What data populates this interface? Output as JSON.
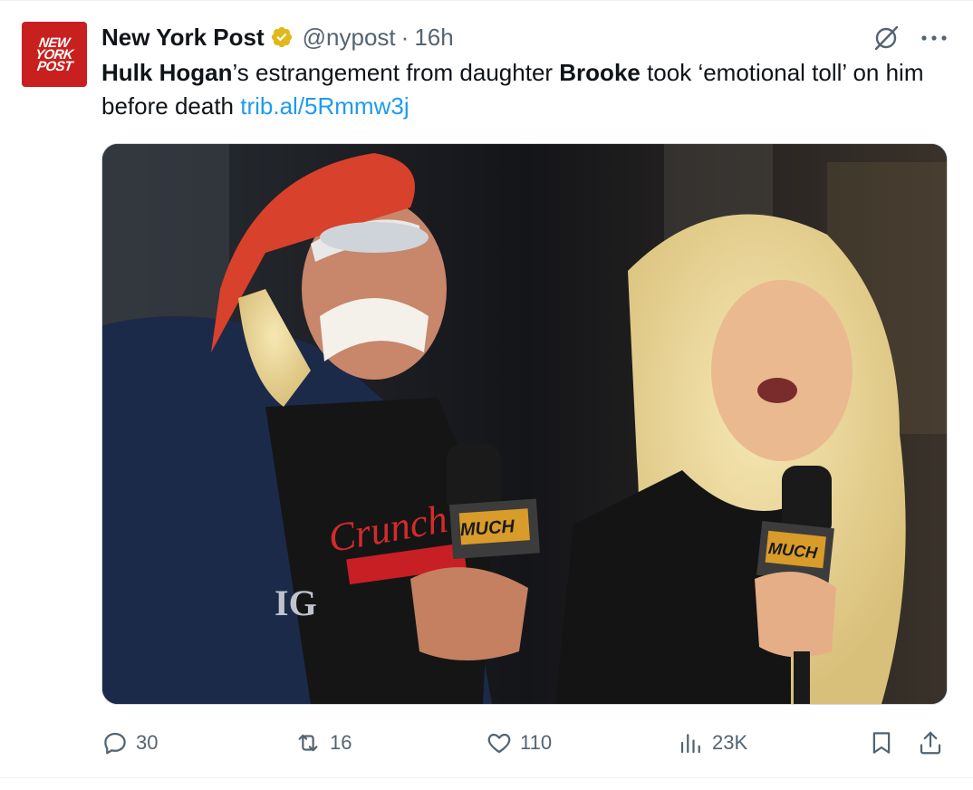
{
  "account": {
    "avatar_lines": [
      "NEW",
      "YORK",
      "POST"
    ],
    "name": "New York Post",
    "handle": "@nypost",
    "separator": "·",
    "time": "16h"
  },
  "tweet": {
    "text_parts": {
      "p1_bold": "Hulk Hogan",
      "p2": "’s estrangement from daughter ",
      "p3_bold": "Brooke",
      "p4": " took ‘emotional toll’ on him before death ",
      "link": "trib.al/5Rmmw3j"
    }
  },
  "media": {
    "overlay_texts": [
      "Crunch",
      "IG",
      "MUCH",
      "MUCH"
    ]
  },
  "actions": {
    "replies": "30",
    "reposts": "16",
    "likes": "110",
    "views": "23K"
  },
  "colors": {
    "brand_red": "#c8201e",
    "verified_gold": "#e2b719",
    "link_blue": "#1d9bf0",
    "muted_gray": "#536471"
  },
  "icons": [
    "verified-badge-icon",
    "grok-icon",
    "more-icon",
    "reply-icon",
    "repost-icon",
    "like-icon",
    "views-icon",
    "bookmark-icon",
    "share-icon"
  ]
}
